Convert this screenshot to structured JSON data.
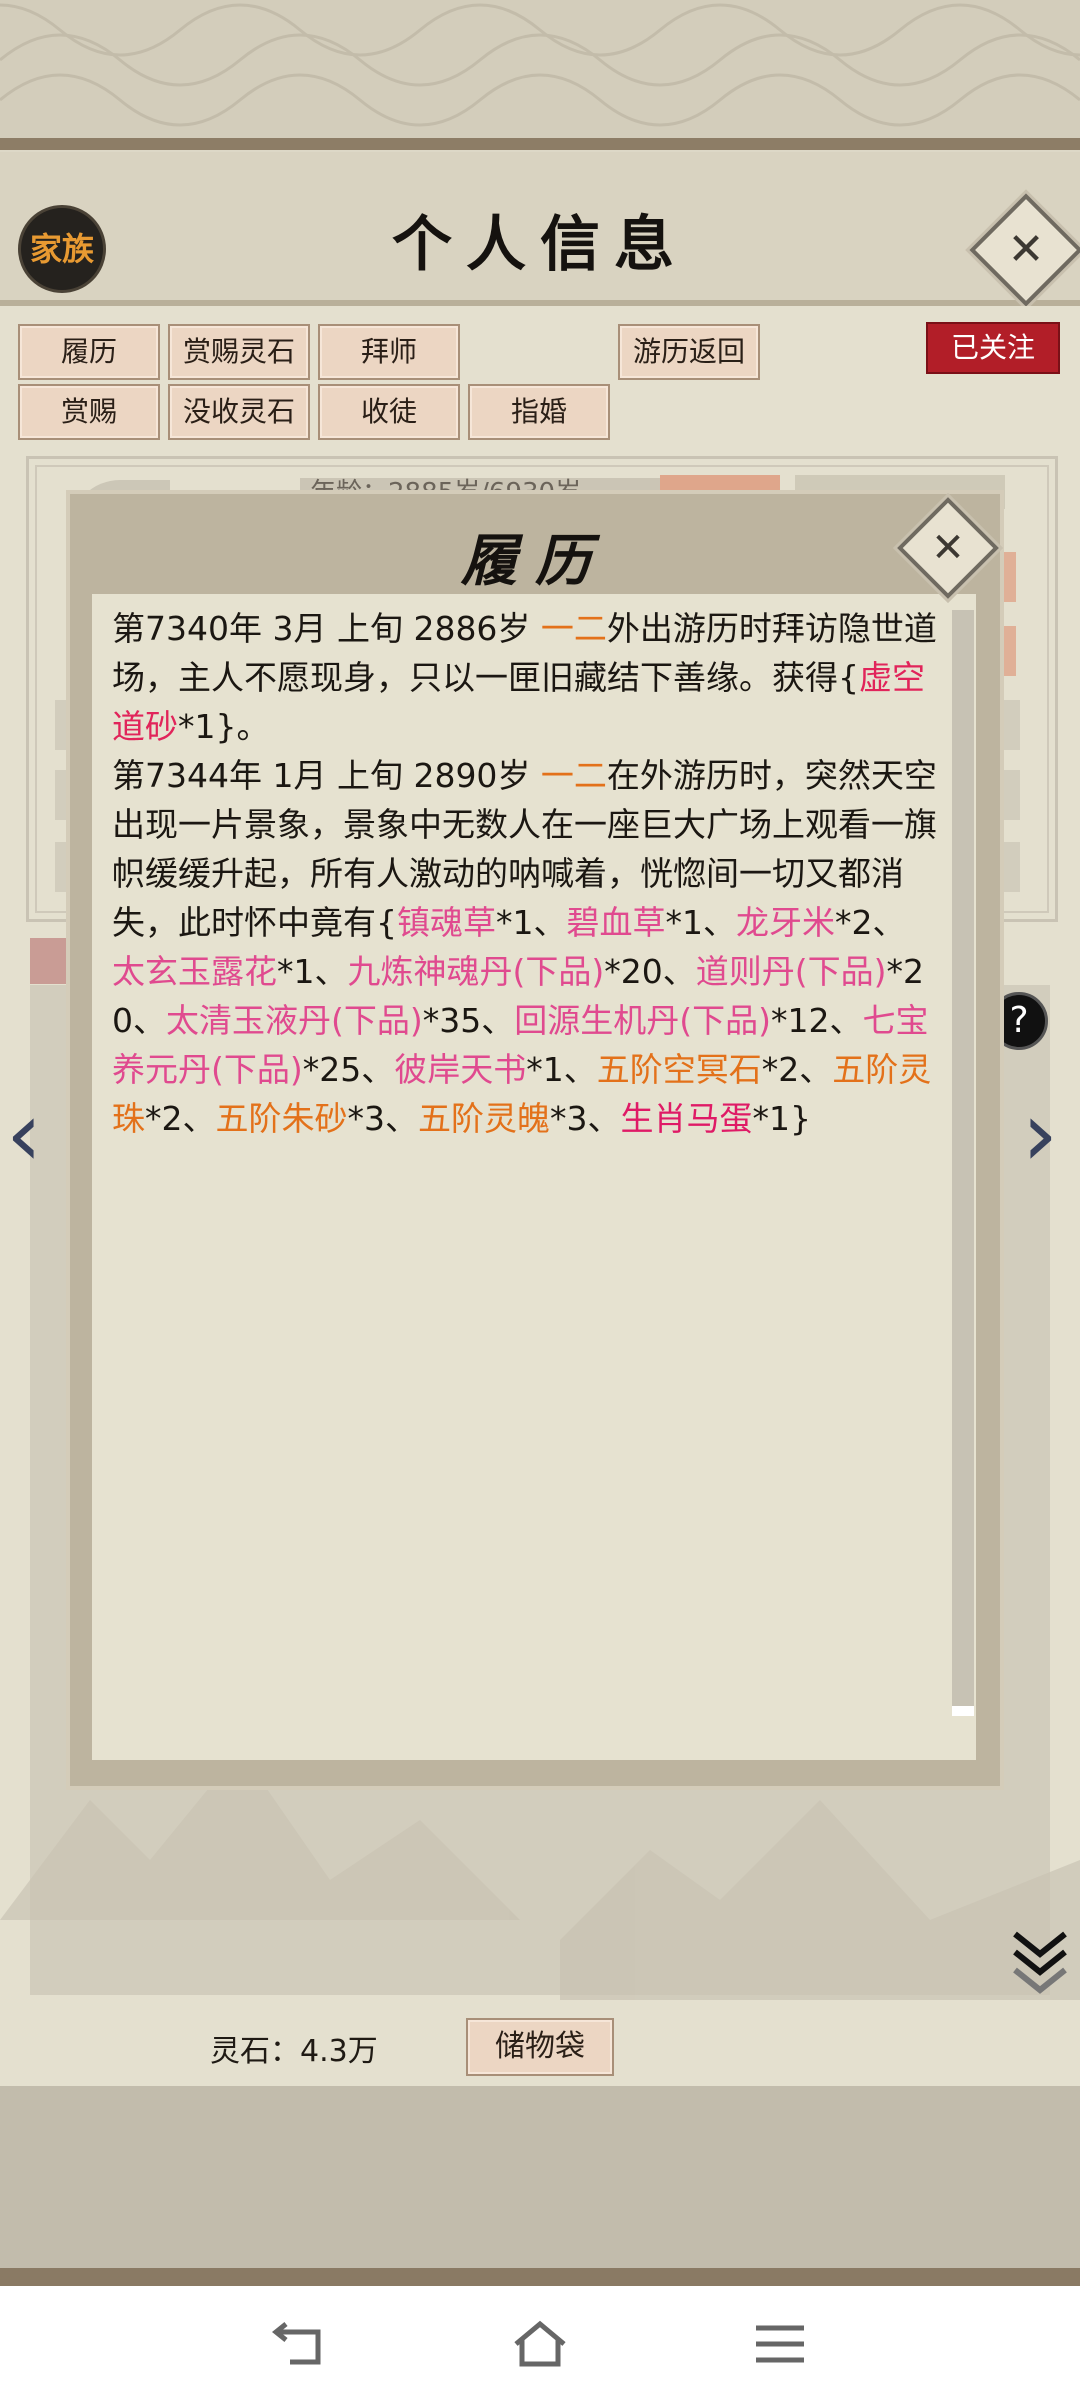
{
  "header": {
    "family_label": "家族",
    "title": "个人信息"
  },
  "buttons_row1": [
    "履历",
    "赏赐灵石",
    "拜师"
  ],
  "travel_return_label": "游历返回",
  "followed_label": "已关注",
  "buttons_row2": [
    "赏赐",
    "没收灵石",
    "收徒",
    "指婚"
  ],
  "profile_peek": {
    "age_text": "年龄：2885岁/6930岁"
  },
  "modal": {
    "title": "履历",
    "entries": [
      {
        "segments": [
          {
            "t": "第7340年 3月 上旬  2886岁 ",
            "c": ""
          },
          {
            "t": "一二",
            "c": "orange"
          },
          {
            "t": "外出游历时拜访隐世道场，主人不愿现身，只以一匣旧藏结下善缘。获得{",
            "c": ""
          },
          {
            "t": "虚空道砂",
            "c": "red"
          },
          {
            "t": "*1}。",
            "c": ""
          }
        ]
      },
      {
        "segments": [
          {
            "t": "第7344年 1月 上旬  2890岁 ",
            "c": ""
          },
          {
            "t": "一二",
            "c": "orange"
          },
          {
            "t": "在外游历时，突然天空出现一片景象，景象中无数人在一座巨大广场上观看一旗帜缓缓升起，所有人激动的呐喊着，恍惚间一切又都消失，此时怀中竟有{",
            "c": ""
          },
          {
            "t": "镇魂草",
            "c": "pink"
          },
          {
            "t": "*1、",
            "c": ""
          },
          {
            "t": "碧血草",
            "c": "pink"
          },
          {
            "t": "*1、",
            "c": ""
          },
          {
            "t": "龙牙米",
            "c": "pink"
          },
          {
            "t": "*2、",
            "c": ""
          },
          {
            "t": "太玄玉露花",
            "c": "pink"
          },
          {
            "t": "*1、",
            "c": ""
          },
          {
            "t": "九炼神魂丹(下品)",
            "c": "pink"
          },
          {
            "t": "*20、",
            "c": ""
          },
          {
            "t": "道则丹(下品)",
            "c": "pink"
          },
          {
            "t": "*20、",
            "c": ""
          },
          {
            "t": "太清玉液丹(下品)",
            "c": "pink"
          },
          {
            "t": "*35、",
            "c": ""
          },
          {
            "t": "回源生机丹(下品)",
            "c": "pink"
          },
          {
            "t": "*12、",
            "c": ""
          },
          {
            "t": "七宝养元丹(下品)",
            "c": "pink"
          },
          {
            "t": "*25、",
            "c": ""
          },
          {
            "t": "彼岸天书",
            "c": "pink"
          },
          {
            "t": "*1、",
            "c": ""
          },
          {
            "t": "五阶空冥石",
            "c": "orange"
          },
          {
            "t": "*2、",
            "c": ""
          },
          {
            "t": "五阶灵珠",
            "c": "orange"
          },
          {
            "t": "*2、",
            "c": ""
          },
          {
            "t": "五阶朱砂",
            "c": "orange"
          },
          {
            "t": "*3、",
            "c": ""
          },
          {
            "t": "五阶灵魄",
            "c": "orange"
          },
          {
            "t": "*3、",
            "c": ""
          },
          {
            "t": "生肖马蛋",
            "c": "deep"
          },
          {
            "t": "*1}",
            "c": ""
          }
        ]
      }
    ]
  },
  "footer": {
    "stones_label": "灵石：4.3万",
    "bag_label": "储物袋"
  },
  "icons": {
    "close": "close-icon",
    "prev": "chevron-left-icon",
    "next": "chevron-right-icon",
    "help": "help-icon",
    "expand": "double-chevron-down-icon",
    "nav_back": "back-icon",
    "nav_home": "home-icon",
    "nav_menu": "menu-icon"
  },
  "colors": {
    "orange_item": "#e3711a",
    "pink_item": "#e04a8f",
    "red_item": "#e1245a",
    "followed_bg": "#b21e28"
  }
}
